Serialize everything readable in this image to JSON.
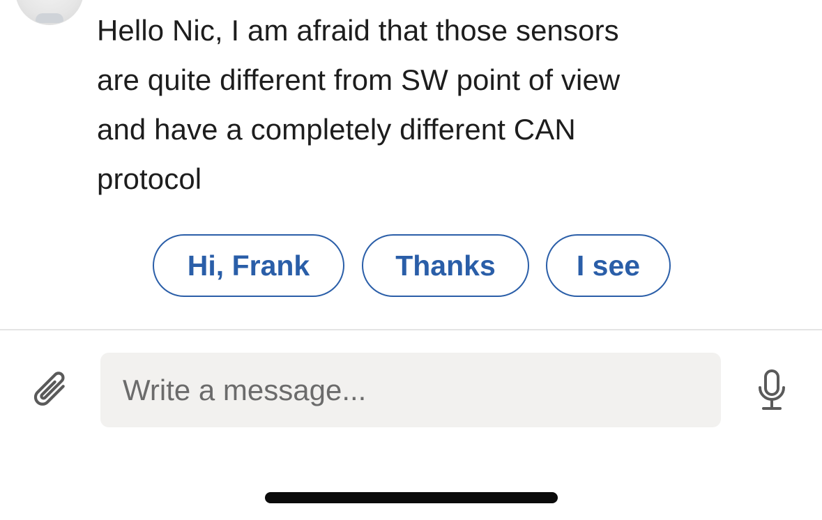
{
  "message": {
    "lines": [
      "Hello Nic, I am afraid that those sensors",
      "are quite different from SW point of view",
      "and have a completely different CAN",
      "protocol"
    ]
  },
  "quick_replies": [
    "Hi, Frank",
    "Thanks",
    "I see"
  ],
  "composer": {
    "placeholder": "Write a message..."
  },
  "icons": {
    "attach": "paperclip-icon",
    "mic": "microphone-icon"
  },
  "colors": {
    "accent": "#2a5ea8",
    "text": "#1d1d1d",
    "input_bg": "#f2f1ef",
    "placeholder": "#6b6b6b"
  }
}
